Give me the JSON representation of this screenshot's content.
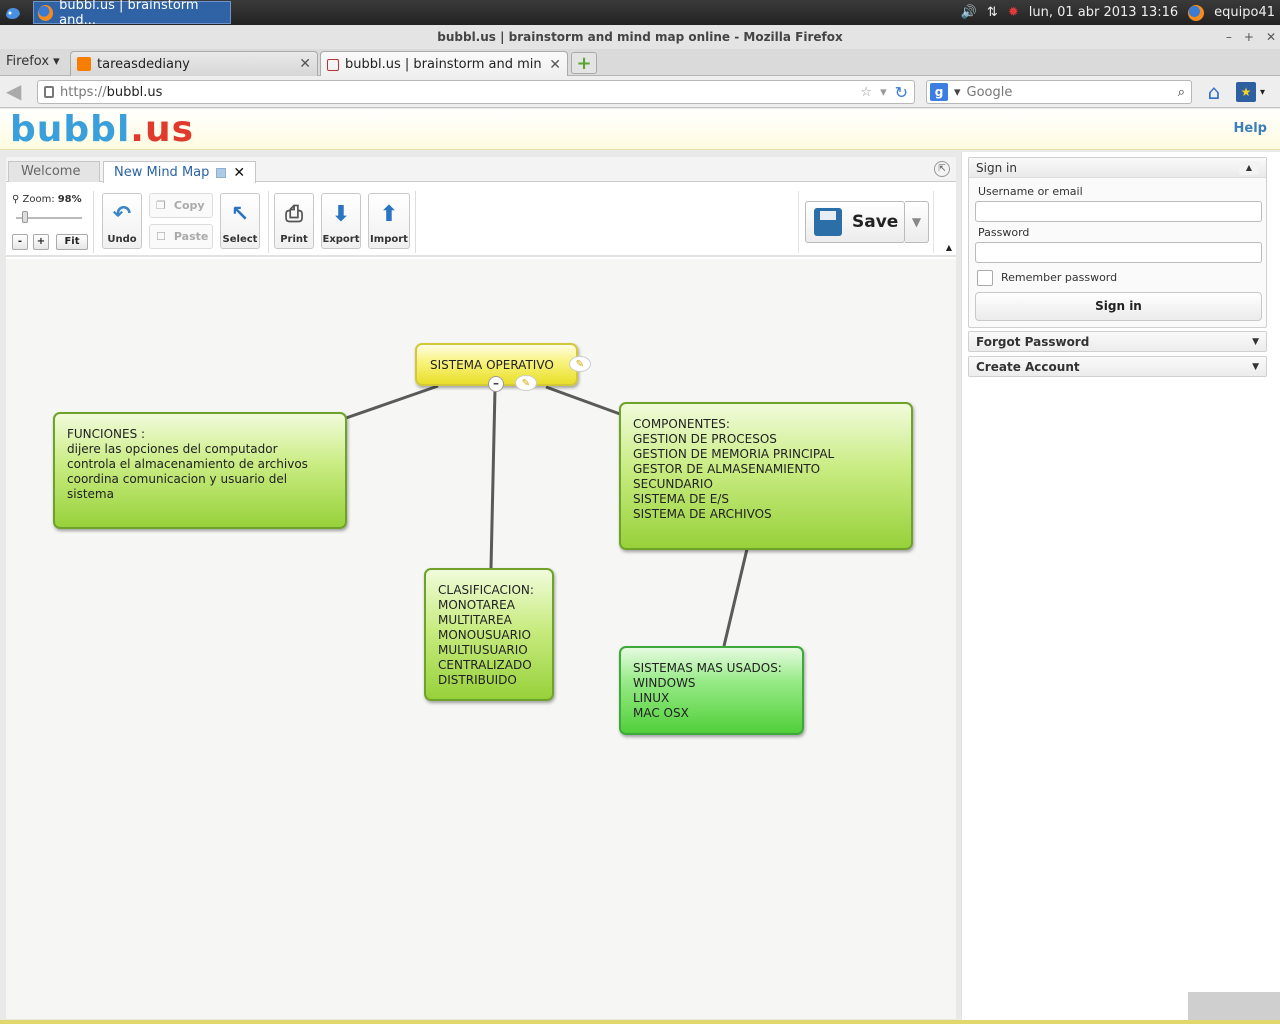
{
  "os_panel": {
    "taskbar_window": "bubbl.us | brainstorm and...",
    "clock": "lun, 01 abr 2013 13:16",
    "user": "equipo41"
  },
  "window": {
    "title": "bubbl.us | brainstorm and mind map online - Mozilla Firefox"
  },
  "browser": {
    "menu_label": "Firefox",
    "tabs": [
      {
        "label": "tareasdediany"
      },
      {
        "label": "bubbl.us | brainstorm and min..."
      }
    ],
    "url_protocol": "https://",
    "url_host": "bubbl.us",
    "search_placeholder": "Google"
  },
  "app": {
    "logo_part1": "bubbl",
    "logo_part2": ".us",
    "help_label": "Help",
    "editor_tabs": [
      {
        "label": "Welcome"
      },
      {
        "label": "New Mind Map"
      }
    ],
    "toolbar": {
      "zoom_label": "Zoom:",
      "zoom_value": "98%",
      "zoom_minus": "-",
      "zoom_plus": "+",
      "fit_label": "Fit",
      "undo_label": "Undo",
      "copy_label": "Copy",
      "paste_label": "Paste",
      "select_label": "Select",
      "print_label": "Print",
      "export_label": "Export",
      "import_label": "Import",
      "save_label": "Save"
    },
    "mindmap": {
      "root": "SISTEMA OPERATIVO",
      "funciones": "FUNCIONES :\ndijere las opciones del computador\ncontrola el almacenamiento de archivos\ncoordina comunicacion y usuario del\nsistema",
      "componentes": "COMPONENTES:\nGESTION DE PROCESOS\nGESTION DE MEMORIA PRINCIPAL\nGESTOR DE ALMASENAMIENTO\nSECUNDARIO\nSISTEMA DE E/S\nSISTEMA DE ARCHIVOS",
      "clasificacion": "CLASIFICACION:\nMONOTAREA\nMULTITAREA\nMONOUSUARIO\nMULTIUSUARIO\nCENTRALIZADO\nDISTRIBUIDO",
      "sistemas": "SISTEMAS MAS USADOS:\nWINDOWS\nLINUX\nMAC OSX"
    },
    "signin_panel": {
      "title": "Sign in",
      "username_label": "Username or email",
      "password_label": "Password",
      "remember_label": "Remember password",
      "button_label": "Sign in"
    },
    "forgot_panel": {
      "title": "Forgot Password"
    },
    "create_panel": {
      "title": "Create Account"
    }
  },
  "colors": {
    "node_green": "#97d13a",
    "node_yellow": "#e9df2b",
    "node_bright_green": "#52cf3a",
    "accent_blue": "#3aa0db",
    "accent_red": "#e03a2c"
  }
}
